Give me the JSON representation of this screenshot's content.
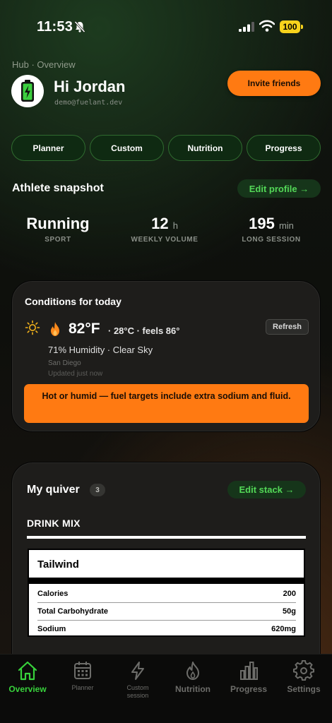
{
  "status_bar": {
    "time": "11:53",
    "battery": "100"
  },
  "header": {
    "breadcrumb": "Hub · Overview",
    "greeting": "Hi Jordan",
    "email": "demo@fuelant.dev",
    "invite_label": "Invite friends"
  },
  "quick_nav": [
    "Planner",
    "Custom",
    "Nutrition",
    "Progress"
  ],
  "snapshot": {
    "title": "Athlete snapshot",
    "edit_label": "Edit profile →",
    "stats": [
      {
        "value": "Running",
        "unit": "",
        "label": "SPORT"
      },
      {
        "value": "12",
        "unit": "h",
        "label": "WEEKLY VOLUME"
      },
      {
        "value": "195",
        "unit": "min",
        "label": "LONG SESSION"
      }
    ]
  },
  "conditions": {
    "title": "Conditions for today",
    "temp": "82°F",
    "temp_detail": "· 28°C · feels 86°",
    "refresh_label": "Refresh",
    "humidity": "71% Humidity · Clear Sky",
    "city": "San Diego",
    "updated": "Updated just now",
    "alert": "Hot or humid — fuel targets include extra sodium and fluid.",
    "colors": {
      "alert": "#ff7a12"
    }
  },
  "quiver": {
    "title": "My quiver",
    "count": "3",
    "edit_label": "Edit stack →",
    "category": "DRINK MIX",
    "product": "Tailwind",
    "nutrition": [
      {
        "name": "Calories",
        "value": "200"
      },
      {
        "name": "Total Carbohydrate",
        "value": "50g"
      },
      {
        "name": "Sodium",
        "value": "620mg"
      }
    ]
  },
  "tabbar": {
    "items": [
      {
        "label": "Overview",
        "icon": "home-icon",
        "active": true
      },
      {
        "label": "Planner",
        "icon": "calendar-icon",
        "active": false
      },
      {
        "label": "Custom session",
        "icon": "lightning-icon",
        "active": false
      },
      {
        "label": "Nutrition",
        "icon": "flame-icon",
        "active": false
      },
      {
        "label": "Progress",
        "icon": "bar-chart-icon",
        "active": false
      },
      {
        "label": "Settings",
        "icon": "gear-icon",
        "active": false
      }
    ],
    "colors": {
      "active": "#38d23c",
      "inactive": "#6d6d6a"
    }
  }
}
